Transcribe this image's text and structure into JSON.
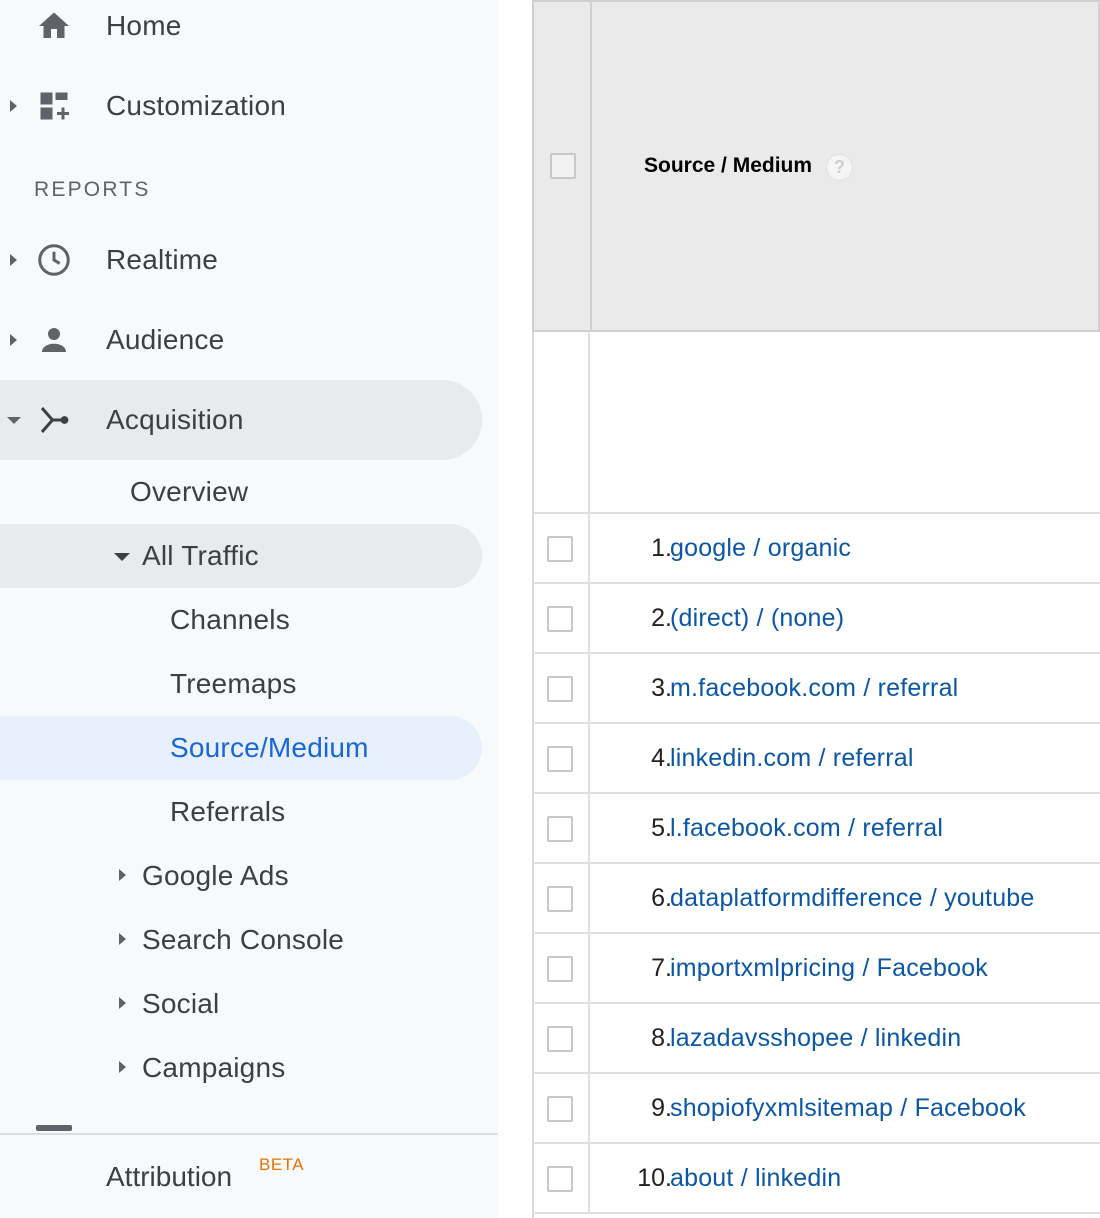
{
  "sidebar": {
    "home": "Home",
    "customization": "Customization",
    "reports_section": "REPORTS",
    "realtime": "Realtime",
    "audience": "Audience",
    "acquisition": "Acquisition",
    "overview": "Overview",
    "all_traffic": "All Traffic",
    "channels": "Channels",
    "treemaps": "Treemaps",
    "source_medium": "Source/Medium",
    "referrals": "Referrals",
    "google_ads": "Google Ads",
    "search_console": "Search Console",
    "social": "Social",
    "campaigns": "Campaigns",
    "attribution": "Attribution",
    "attribution_badge": "BETA"
  },
  "table": {
    "column_header": "Source / Medium",
    "help_glyph": "?",
    "rows": [
      {
        "index": "1.",
        "source": "google / organic"
      },
      {
        "index": "2.",
        "source": "(direct) / (none)"
      },
      {
        "index": "3.",
        "source": "m.facebook.com / referral"
      },
      {
        "index": "4.",
        "source": "linkedin.com / referral"
      },
      {
        "index": "5.",
        "source": "l.facebook.com / referral"
      },
      {
        "index": "6.",
        "source": "dataplatformdifference / youtube"
      },
      {
        "index": "7.",
        "source": "importxmlpricing / Facebook"
      },
      {
        "index": "8.",
        "source": "lazadavsshopee / linkedin"
      },
      {
        "index": "9.",
        "source": "shopiofyxmlsitemap / Facebook"
      },
      {
        "index": "10.",
        "source": "about / linkedin"
      }
    ]
  },
  "colors": {
    "accent": "#1967d2",
    "link": "#0b57a6",
    "beta": "#e37400"
  }
}
